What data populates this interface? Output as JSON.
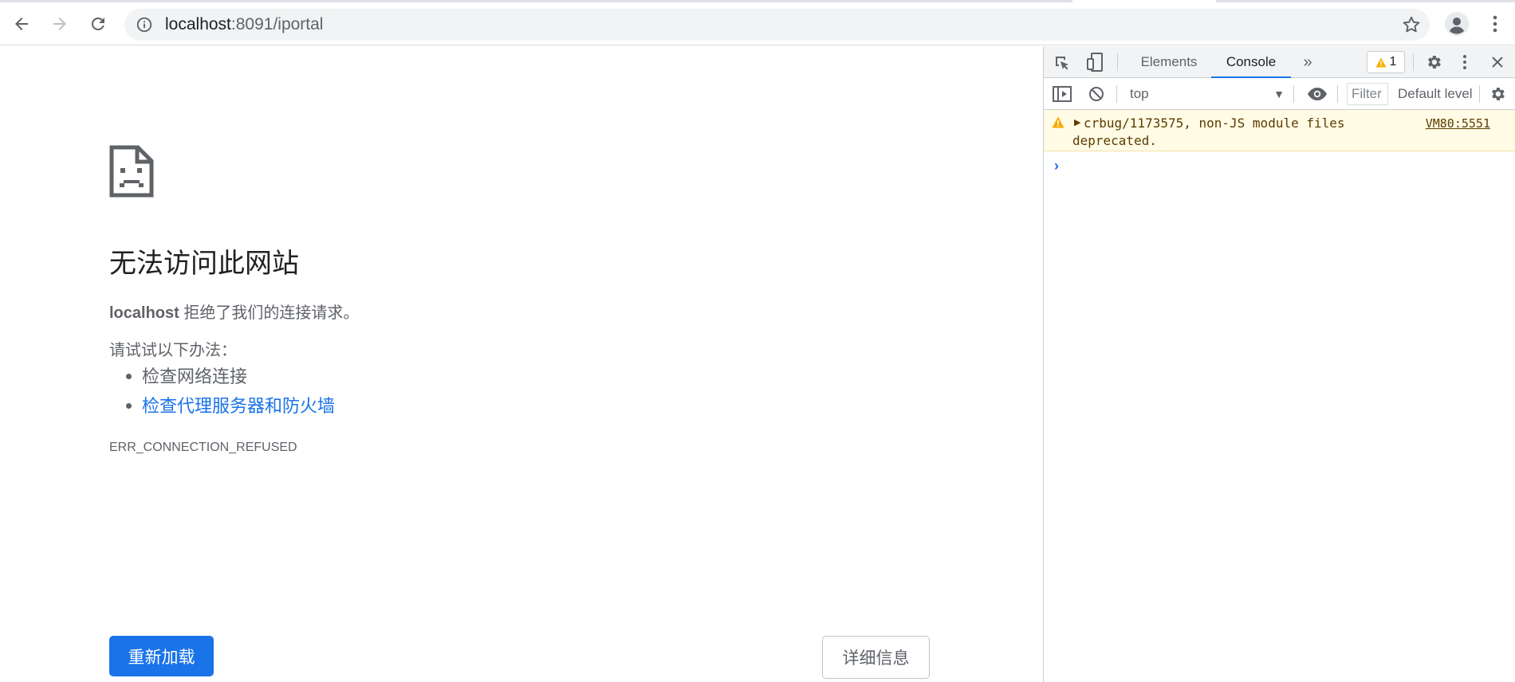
{
  "browser": {
    "url_host": "localhost",
    "url_rest": ":8091/iportal",
    "icons": {
      "back": "arrow-left-icon",
      "forward": "arrow-right-icon",
      "reload": "reload-icon",
      "site_info": "info-icon",
      "bookmark": "star-icon",
      "profile": "avatar-icon",
      "menu": "kebab-menu-icon"
    }
  },
  "error_page": {
    "title": "无法访问此网站",
    "host": "localhost",
    "host_message": " 拒绝了我们的连接请求。",
    "try_label": "请试试以下办法：",
    "suggestions": [
      "检查网络连接",
      "检查代理服务器和防火墙"
    ],
    "error_code": "ERR_CONNECTION_REFUSED",
    "reload_button": "重新加载",
    "details_button": "详细信息"
  },
  "devtools": {
    "tabs": [
      "Elements",
      "Console"
    ],
    "active_tab": "Console",
    "more_tabs": "»",
    "warning_count": "1",
    "context": "top",
    "filter_placeholder": "Filter",
    "levels_label": "Default levels",
    "messages": [
      {
        "level": "warning",
        "text": "crbug/1173575, non-JS module files deprecated.",
        "source": "VM80:5551"
      }
    ],
    "prompt_symbol": "›",
    "colors": {
      "accent": "#1a73e8",
      "warning_bg": "#fffbe5",
      "warning_icon": "#f9ab00"
    }
  }
}
